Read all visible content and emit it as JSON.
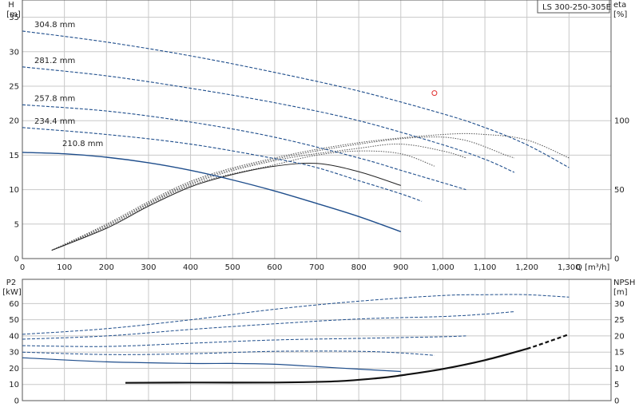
{
  "chart_data": [
    {
      "type": "line",
      "title": "LS 300-250-305E",
      "xlabel": "Q [m³/h]",
      "x_tick_labels": [
        "0",
        "100",
        "200",
        "300",
        "400",
        "500",
        "600",
        "700",
        "800",
        "900",
        "1,000",
        "1,100",
        "1,200",
        "1,300"
      ],
      "xlim": [
        0,
        1400
      ],
      "left_axis": {
        "label": "H",
        "unit": "[m]",
        "ylim": [
          0,
          37.5
        ],
        "ticks": [
          "0",
          "5",
          "10",
          "15",
          "20",
          "25",
          "30",
          "35"
        ]
      },
      "right_axis": {
        "label": "eta",
        "unit": "[%]",
        "ylim": [
          0,
          187.5
        ],
        "ticks": [
          "0",
          "50",
          "100"
        ]
      },
      "grid": true,
      "head_series": [
        {
          "name": "304.8 mm",
          "style": "dashed",
          "x": [
            0,
            200,
            400,
            600,
            800,
            1000,
            1100,
            1200,
            1300
          ],
          "y": [
            33,
            31.4,
            29.4,
            27,
            24.3,
            21,
            19,
            16.5,
            13.2
          ]
        },
        {
          "name": "281.2 mm",
          "style": "dashed",
          "x": [
            0,
            200,
            400,
            600,
            800,
            1000,
            1100,
            1170
          ],
          "y": [
            27.8,
            26.5,
            24.7,
            22.6,
            20,
            16.5,
            14.4,
            12.5
          ]
        },
        {
          "name": "257.8 mm",
          "style": "dashed",
          "x": [
            0,
            200,
            400,
            600,
            800,
            900,
            1000,
            1055
          ],
          "y": [
            22.3,
            21.4,
            19.8,
            17.6,
            14.6,
            12.8,
            11,
            10
          ]
        },
        {
          "name": "234.4 mm",
          "style": "dashed",
          "x": [
            0,
            200,
            400,
            600,
            700,
            800,
            900,
            950
          ],
          "y": [
            19,
            18,
            16.6,
            14.5,
            13.2,
            11.3,
            9.4,
            8.3
          ]
        },
        {
          "name": "210.8 mm",
          "style": "solid",
          "x": [
            0,
            100,
            200,
            300,
            400,
            500,
            600,
            700,
            800,
            900
          ],
          "y": [
            15.4,
            15.2,
            14.7,
            13.9,
            12.8,
            11.4,
            9.8,
            8,
            6.1,
            3.9
          ]
        }
      ],
      "eta_series": [
        {
          "style": "dotted",
          "x": [
            70,
            200,
            400,
            600,
            800,
            1000,
            1100,
            1200,
            1300
          ],
          "y": [
            6,
            25,
            56,
            73,
            84,
            90,
            90,
            86,
            73
          ]
        },
        {
          "style": "dotted",
          "x": [
            70,
            200,
            400,
            600,
            800,
            950,
            1050,
            1150,
            1170
          ],
          "y": [
            6,
            24,
            55,
            72,
            83,
            88,
            86,
            75,
            73
          ]
        },
        {
          "style": "dotted",
          "x": [
            70,
            200,
            400,
            600,
            800,
            900,
            1000,
            1055
          ],
          "y": [
            6,
            24,
            54,
            71,
            80,
            83,
            78,
            73
          ]
        },
        {
          "style": "dotted",
          "x": [
            70,
            200,
            400,
            600,
            700,
            800,
            900,
            980
          ],
          "y": [
            6,
            23,
            53,
            68,
            75,
            78,
            76,
            67
          ]
        },
        {
          "style": "solid",
          "x": [
            70,
            200,
            300,
            400,
            500,
            600,
            700,
            800,
            900
          ],
          "y": [
            6,
            22,
            38,
            52,
            61,
            67,
            69,
            63,
            53
          ]
        }
      ],
      "operating_point": {
        "x": 980,
        "y": 24
      }
    },
    {
      "type": "line",
      "xlim": [
        0,
        1400
      ],
      "left_axis": {
        "label": "P2",
        "unit": "[kW]",
        "ylim": [
          0,
          75
        ],
        "ticks": [
          "0",
          "10",
          "20",
          "30",
          "40",
          "50",
          "60"
        ]
      },
      "right_axis": {
        "label": "NPSH",
        "unit": "[m]",
        "ylim": [
          0,
          37.5
        ],
        "ticks": [
          "0",
          "5",
          "10",
          "15",
          "20",
          "25",
          "30"
        ]
      },
      "grid": true,
      "power_series": [
        {
          "name": "304.8 mm",
          "style": "dashed",
          "x": [
            0,
            200,
            400,
            600,
            800,
            1000,
            1100,
            1200,
            1300
          ],
          "y": [
            41,
            44.5,
            50,
            56.5,
            61.5,
            65,
            65.5,
            65.5,
            64
          ]
        },
        {
          "name": "281.2 mm",
          "style": "dashed",
          "x": [
            0,
            200,
            400,
            600,
            800,
            1000,
            1100,
            1170
          ],
          "y": [
            38,
            40,
            44,
            47.5,
            50.5,
            52,
            53.5,
            55
          ]
        },
        {
          "name": "257.8 mm",
          "style": "dashed",
          "x": [
            0,
            200,
            400,
            600,
            800,
            900,
            1000,
            1055
          ],
          "y": [
            34,
            33.5,
            35.5,
            37.5,
            38.5,
            39,
            39.5,
            40
          ]
        },
        {
          "name": "234.4 mm",
          "style": "dashed",
          "x": [
            0,
            200,
            400,
            600,
            800,
            900,
            980
          ],
          "y": [
            30,
            28.5,
            29,
            30.5,
            30.5,
            29.5,
            28
          ]
        },
        {
          "name": "210.8 mm",
          "style": "solid",
          "x": [
            0,
            200,
            400,
            500,
            600,
            700,
            800,
            900
          ],
          "y": [
            26.5,
            24,
            23,
            23,
            22.5,
            21,
            19.5,
            18
          ]
        }
      ],
      "npsh_series": [
        {
          "style": "solid",
          "x": [
            245,
            400,
            600,
            750,
            850,
            900,
            1000,
            1100,
            1200
          ],
          "y": [
            5.5,
            5.6,
            5.6,
            6,
            7,
            7.8,
            9.8,
            12.5,
            16
          ]
        },
        {
          "style": "dashed",
          "x": [
            1200,
            1250,
            1300
          ],
          "y": [
            16,
            18.2,
            20.5
          ]
        }
      ]
    }
  ]
}
